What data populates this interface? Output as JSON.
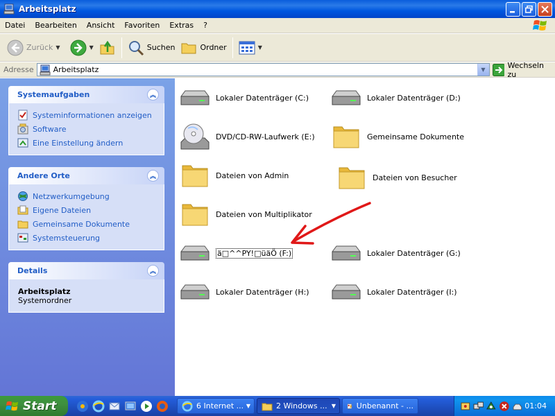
{
  "window": {
    "title": "Arbeitsplatz"
  },
  "menu": [
    "Datei",
    "Bearbeiten",
    "Ansicht",
    "Favoriten",
    "Extras",
    "?"
  ],
  "toolbar": {
    "back": "Zurück",
    "search": "Suchen",
    "folders": "Ordner"
  },
  "address": {
    "label": "Adresse",
    "value": "Arbeitsplatz",
    "go": "Wechseln zu"
  },
  "sidebar": {
    "system_tasks": {
      "title": "Systemaufgaben",
      "links": [
        "Systeminformationen anzeigen",
        "Software",
        "Eine Einstellung ändern"
      ]
    },
    "other_places": {
      "title": "Andere Orte",
      "links": [
        "Netzwerkumgebung",
        "Eigene Dateien",
        "Gemeinsame Dokumente",
        "Systemsteuerung"
      ]
    },
    "details": {
      "title": "Details",
      "name": "Arbeitsplatz",
      "type": "Systemordner"
    }
  },
  "items": [
    {
      "label": "Lokaler Datenträger (C:)",
      "icon": "hard-drive-icon"
    },
    {
      "label": "Lokaler Datenträger (D:)",
      "icon": "hard-drive-icon"
    },
    {
      "label": "DVD/CD-RW-Laufwerk (E:)",
      "icon": "cd-drive-icon"
    },
    {
      "label": "Gemeinsame Dokumente",
      "icon": "folder-icon"
    },
    {
      "label": "Dateien von Admin",
      "icon": "folder-icon"
    },
    {
      "label": "Dateien von Besucher",
      "icon": "folder-icon"
    },
    {
      "label": "Dateien von Multiplikator",
      "icon": "folder-icon"
    },
    {
      "label": "ä□^^PY!□üäÖ (F:)",
      "icon": "hard-drive-icon"
    },
    {
      "label": "Lokaler Datenträger (G:)",
      "icon": "hard-drive-icon"
    },
    {
      "label": "Lokaler Datenträger (H:)",
      "icon": "hard-drive-icon"
    },
    {
      "label": "Lokaler Datenträger (I:)",
      "icon": "hard-drive-icon"
    }
  ],
  "taskbar": {
    "start": "Start",
    "tasks": [
      "6 Internet ...",
      "2 Windows ...",
      "Unbenannt - ..."
    ],
    "clock": "01:04"
  },
  "colors": {
    "annotation_arrow": "#e01818",
    "link": "#215dc6",
    "taskbar": "#245edb"
  }
}
